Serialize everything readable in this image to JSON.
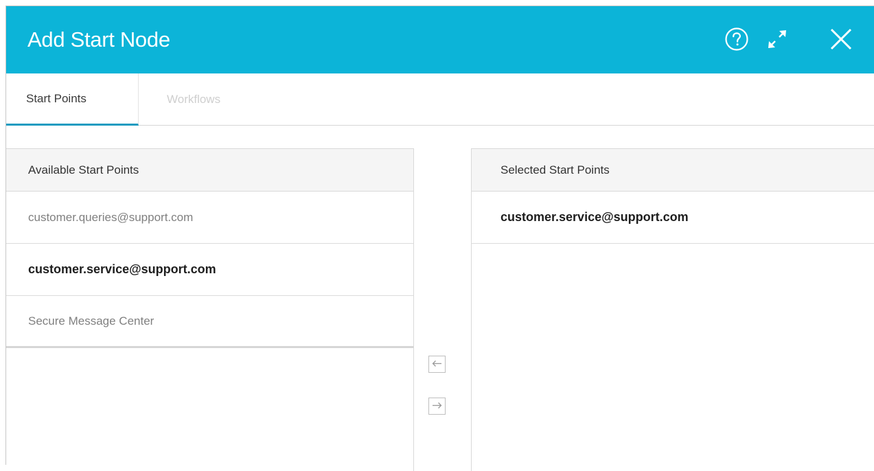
{
  "dialog": {
    "title": "Add Start Node",
    "header_color": "#0cb4d8",
    "actions": [
      {
        "name": "help",
        "icon": "help-circle-icon"
      },
      {
        "name": "expand",
        "icon": "expand-arrows-icon"
      },
      {
        "name": "close",
        "icon": "close-icon"
      }
    ]
  },
  "tabs": [
    {
      "label": "Start Points",
      "active": true
    },
    {
      "label": "Workflows",
      "active": false
    }
  ],
  "available": {
    "header": "Available Start Points",
    "items": [
      {
        "label": "customer.queries@support.com",
        "selected": false
      },
      {
        "label": "customer.service@support.com",
        "selected": true
      },
      {
        "label": "Secure Message Center",
        "selected": false
      }
    ]
  },
  "selected": {
    "header": "Selected Start Points",
    "items": [
      {
        "label": "customer.service@support.com"
      }
    ]
  },
  "transfer": {
    "move_left_icon": "arrow-left-icon",
    "move_right_icon": "arrow-right-icon"
  }
}
